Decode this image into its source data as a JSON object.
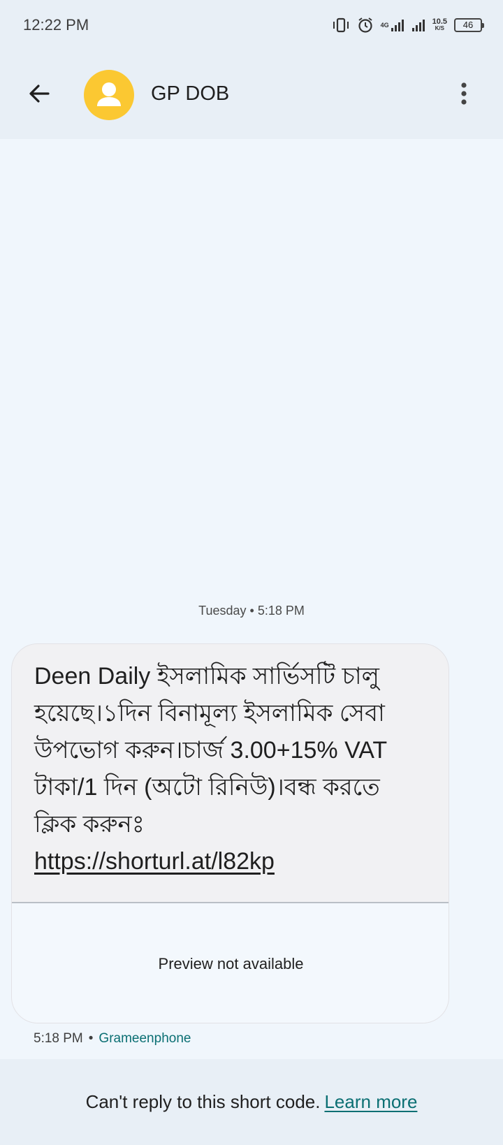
{
  "status_bar": {
    "time": "12:22 PM",
    "net_speed_value": "10.5",
    "net_speed_unit": "K/S",
    "network_label": "4G",
    "battery": "46",
    "icons": [
      "vibrate-icon",
      "alarm-icon",
      "signal-4g-icon",
      "signal-icon",
      "battery-icon"
    ]
  },
  "app_bar": {
    "contact_name": "GP DOB",
    "back_icon": "arrow-back-icon",
    "menu_icon": "more-vert-icon",
    "avatar_color": "#fbc832"
  },
  "conversation": {
    "date_separator": "Tuesday • 5:18 PM",
    "message": {
      "text": "Deen Daily ইসলামিক সার্ভিসটি চালু হয়েছে।১দিন বিনামূল্য ইসলামিক সেবা উপভোগ করুন।চার্জ 3.00+15% VAT টাকা/1 দিন (অটো রিনিউ)।বন্ধ করতে ক্লিক করুনঃ",
      "link": "https://shorturl.at/l82kp",
      "preview_text": "Preview not available",
      "time": "5:18 PM",
      "separator": "•",
      "carrier": "Grameenphone"
    }
  },
  "footer": {
    "text": "Can't reply to this short code.",
    "link_label": "Learn more"
  },
  "colors": {
    "background": "#f0f6fc",
    "bar": "#e8eff6",
    "accent": "#0b6f73",
    "bubble": "#f1f1f3"
  }
}
